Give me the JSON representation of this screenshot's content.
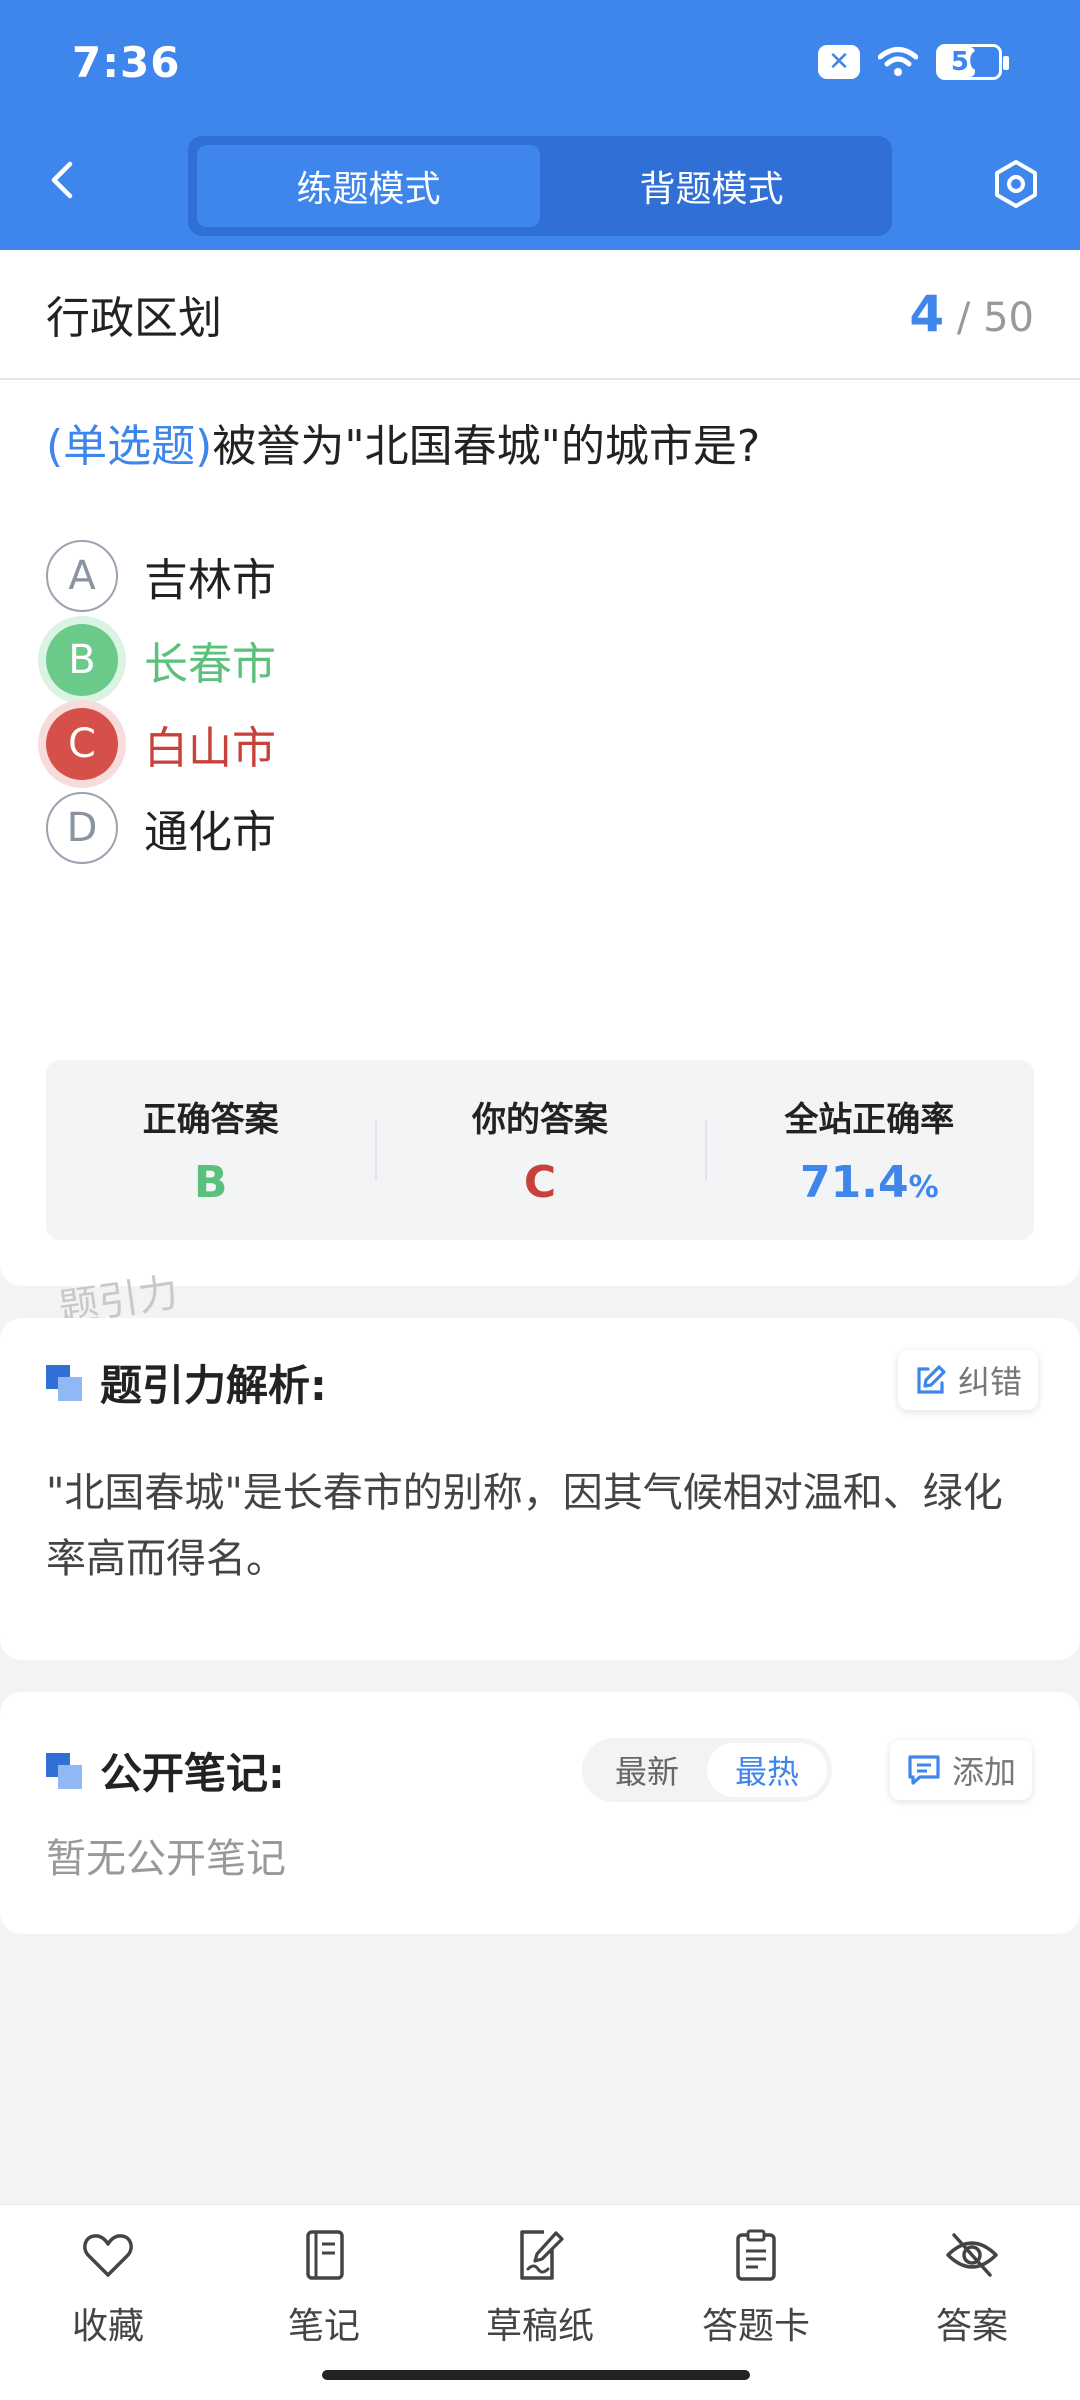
{
  "status_bar": {
    "time": "7:36",
    "battery": "50"
  },
  "header": {
    "tabs": [
      {
        "label": "练题模式",
        "active": true
      },
      {
        "label": "背题模式",
        "active": false
      }
    ]
  },
  "question": {
    "category": "行政区划",
    "current": "4",
    "total": "/ 50",
    "type_label": "(单选题)",
    "text": "被誉为\"北国春城\"的城市是?",
    "options": [
      {
        "letter": "A",
        "text": "吉林市",
        "state": "normal"
      },
      {
        "letter": "B",
        "text": "长春市",
        "state": "correct"
      },
      {
        "letter": "C",
        "text": "白山市",
        "state": "wrong"
      },
      {
        "letter": "D",
        "text": "通化市",
        "state": "normal"
      }
    ]
  },
  "result": {
    "correct_label": "正确答案",
    "correct_value": "B",
    "yours_label": "你的答案",
    "yours_value": "C",
    "rate_label": "全站正确率",
    "rate_value": "71.4",
    "rate_unit": "%"
  },
  "watermark": "题引力",
  "analysis": {
    "title": "题引力解析:",
    "report_button": "纠错",
    "text": "\"北国春城\"是长春市的别称，因其气候相对温和、绿化率高而得名。"
  },
  "notes": {
    "title": "公开笔记:",
    "sort_options": [
      {
        "label": "最新",
        "active": false
      },
      {
        "label": "最热",
        "active": true
      }
    ],
    "add_button": "添加",
    "empty_text": "暂无公开笔记"
  },
  "bottom_nav": [
    {
      "label": "收藏",
      "icon": "heart-icon"
    },
    {
      "label": "笔记",
      "icon": "notebook-icon"
    },
    {
      "label": "草稿纸",
      "icon": "draft-paper-icon"
    },
    {
      "label": "答题卡",
      "icon": "answer-sheet-icon"
    },
    {
      "label": "答案",
      "icon": "eye-off-icon"
    }
  ],
  "colors": {
    "primary": "#3f86ec",
    "correct": "#5cc07d",
    "wrong": "#c8413b"
  }
}
